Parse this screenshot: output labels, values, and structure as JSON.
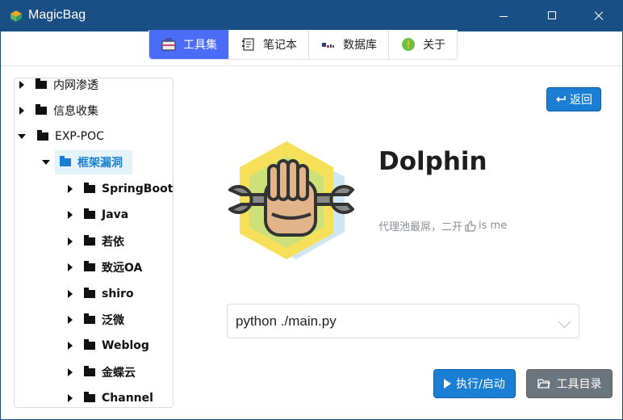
{
  "window": {
    "title": "MagicBag",
    "title_bar_color": "#1a4f86"
  },
  "tabs": [
    {
      "label": "工具集",
      "icon": "toolbox-icon",
      "active": true
    },
    {
      "label": "笔记本",
      "icon": "notebook-icon",
      "active": false
    },
    {
      "label": "数据库",
      "icon": "database-icon",
      "active": false
    },
    {
      "label": "关于",
      "icon": "info-icon",
      "active": false
    }
  ],
  "tree": {
    "items": [
      {
        "label": "内网渗透",
        "expanded": false
      },
      {
        "label": "信息收集",
        "expanded": false
      },
      {
        "label": "EXP-POC",
        "expanded": true
      }
    ],
    "selected": {
      "label": "框架漏洞",
      "expanded": true
    },
    "children": [
      {
        "label": "SpringBoot"
      },
      {
        "label": "Java"
      },
      {
        "label": "若依"
      },
      {
        "label": "致远OA"
      },
      {
        "label": "shiro"
      },
      {
        "label": "泛微"
      },
      {
        "label": "Weblog"
      },
      {
        "label": "金蝶云"
      },
      {
        "label": "Channel"
      }
    ]
  },
  "detail": {
    "back_label": "返回",
    "tool_name": "Dolphin",
    "desc_before": "代理池最屌，二开",
    "desc_after": "is me",
    "command": "python ./main.py",
    "run_label": "执行/启动",
    "dir_label": "工具目录"
  },
  "colors": {
    "accent": "#4a6cf7",
    "primary_button": "#1a7fd4",
    "secondary_button": "#6c757d",
    "selected_node": "#1b7fd1"
  }
}
